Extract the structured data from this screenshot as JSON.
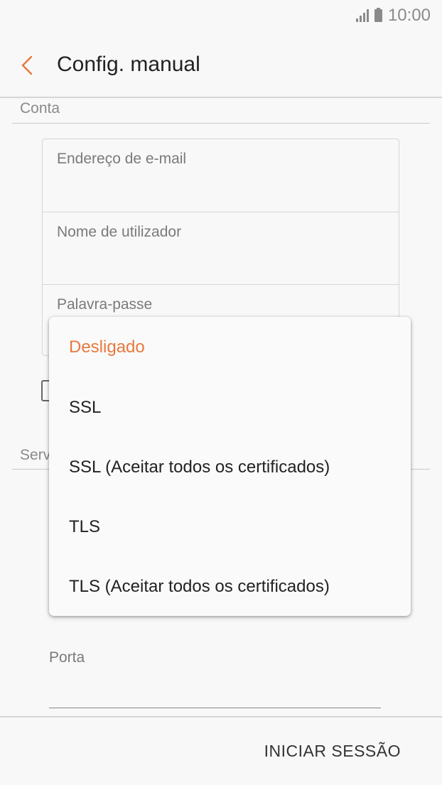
{
  "status_bar": {
    "time": "10:00"
  },
  "app_bar": {
    "title": "Config. manual"
  },
  "account_section": {
    "header": "Conta",
    "fields": [
      {
        "label": "Endereço de e-mail"
      },
      {
        "label": "Nome de utilizador"
      },
      {
        "label": "Palavra-passe"
      }
    ]
  },
  "server_section": {
    "header_partial": "Serv"
  },
  "port_field": {
    "label": "Porta"
  },
  "bottom_bar": {
    "login_label": "INICIAR SESSÃO"
  },
  "security_dropdown": {
    "selected": "Desligado",
    "options": [
      "Desligado",
      "SSL",
      "SSL (Aceitar todos os certificados)",
      "TLS",
      "TLS (Aceitar todos os certificados)"
    ]
  },
  "colors": {
    "accent": "#e8793e",
    "background": "#f8f8f8"
  }
}
